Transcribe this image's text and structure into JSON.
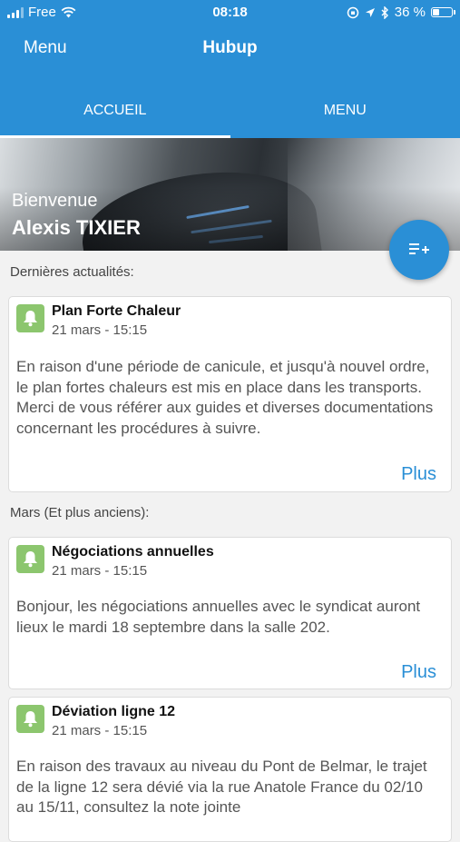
{
  "status_bar": {
    "carrier": "Free",
    "time": "08:18",
    "battery": "36 %",
    "battery_level": 0.36
  },
  "app_bar": {
    "menu_label": "Menu",
    "title": "Hubup"
  },
  "tabs": [
    {
      "label": "ACCUEIL",
      "active": true
    },
    {
      "label": "MENU",
      "active": false
    }
  ],
  "hero": {
    "greeting": "Bienvenue",
    "user_name": "Alexis TIXIER"
  },
  "sections": {
    "latest": "Dernières actualités:",
    "older": "Mars (Et plus anciens):"
  },
  "news": [
    {
      "title": "Plan Forte Chaleur",
      "date": "21 mars - 15:15",
      "body": "En raison d'une période de canicule, et jusqu'à nouvel ordre, le plan fortes chaleurs est mis en place dans les transports. Merci de vous référer aux guides et diverses documentations concernant les procédures à suivre.",
      "more": "Plus"
    },
    {
      "title": "Négociations annuelles",
      "date": "21 mars - 15:15",
      "body": "Bonjour, les négociations annuelles avec le syndicat auront lieux le mardi 18 septembre dans la salle 202.",
      "more": "Plus"
    },
    {
      "title": "Déviation ligne 12",
      "date": "21 mars - 15:15",
      "body": "En raison des travaux au niveau du Pont de Belmar, le trajet de la ligne 12 sera dévié via la rue Anatole France du 02/10 au 15/11, consultez la note jointe",
      "more": ""
    }
  ],
  "colors": {
    "primary": "#2a8fd6",
    "news_icon": "#8cc66e",
    "background": "#f2f2f2"
  },
  "icons": {
    "fab": "playlist-add-icon",
    "news": "bell-icon"
  }
}
